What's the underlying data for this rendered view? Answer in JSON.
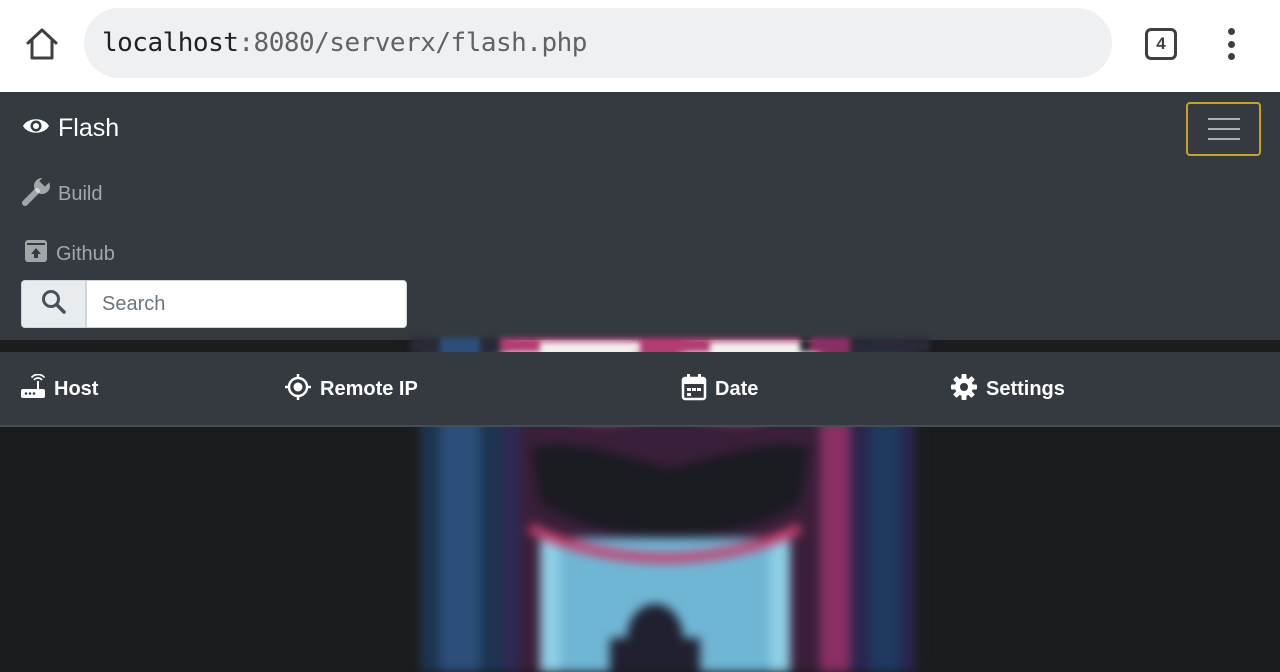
{
  "browser": {
    "url_host": "localhost",
    "url_path": ":8080/serverx/flash.php",
    "tab_count": "4"
  },
  "navbar": {
    "brand": "Flash",
    "links": [
      {
        "label": "Build",
        "icon": "wrench-icon"
      },
      {
        "label": "Github",
        "icon": "archive-icon"
      }
    ],
    "search": {
      "placeholder": "Search"
    }
  },
  "table": {
    "headers": [
      {
        "label": "Host",
        "icon": "router-icon"
      },
      {
        "label": "Remote IP",
        "icon": "crosshair-icon"
      },
      {
        "label": "Date",
        "icon": "calendar-icon"
      },
      {
        "label": "Settings",
        "icon": "gear-icon"
      }
    ]
  },
  "colors": {
    "navbar_bg": "#343a40",
    "toggler_border": "#c8a228",
    "page_bg": "#1b1c1e"
  }
}
